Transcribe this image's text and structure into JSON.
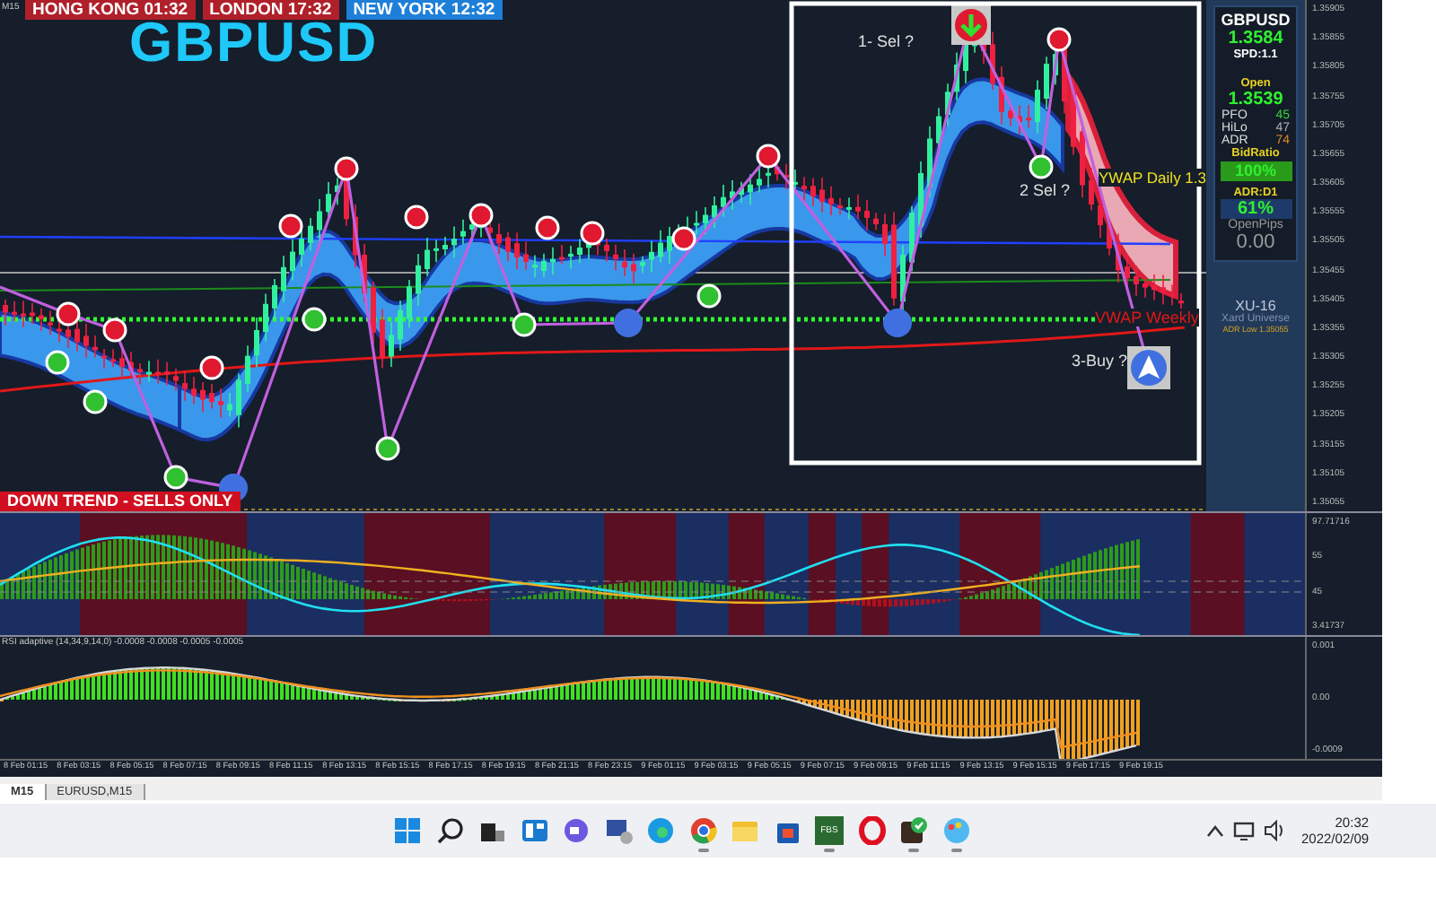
{
  "sessions": [
    {
      "label": "HONG KONG 01:32",
      "color": "#b0202a"
    },
    {
      "label": "LONDON  17:32",
      "color": "#b0202a"
    },
    {
      "label": "NEW YORK  12:32",
      "color": "#1e7fd8"
    }
  ],
  "chart": {
    "timeframe": "M15",
    "symbol_title": "GBPUSD",
    "trend_banner": "DOWN TREND - SELLS ONLY",
    "annotations": [
      {
        "text": "1- Sel ?",
        "kind": "note"
      },
      {
        "text": "YWAP Daily 1.3",
        "kind": "daily"
      },
      {
        "text": "2 Sel ?",
        "kind": "note"
      },
      {
        "text": "VWAP Weekly",
        "kind": "weekly"
      },
      {
        "text": "3-Buy ?",
        "kind": "note"
      }
    ]
  },
  "info_panel": {
    "symbol": "GBPUSD",
    "bid": "1.3584",
    "spread": "SPD:1.1",
    "open_label": "Open",
    "open_value": "1.3539",
    "stats": [
      {
        "label": "PFO",
        "value": "45",
        "color": "#3cd23c"
      },
      {
        "label": "HiLo",
        "value": "47",
        "color": "#b4b4b4"
      },
      {
        "label": "ADR",
        "value": "74",
        "color": "#e08a20"
      }
    ],
    "bid_ratio_label": "BidRatio",
    "bid_ratio": "100%",
    "bid_ratio_meter": {
      "level": 1
    },
    "adr_label": "ADR:D1",
    "adr_value": "61%",
    "open_pips_label": "OpenPips",
    "open_pips": "0.00",
    "brand": "XU-16",
    "brand_sub": "Xard Universe",
    "adr_low": "ADR Low 1.35055"
  },
  "price_axis": [
    "1.35905",
    "1.35855",
    "1.35805",
    "1.35755",
    "1.35705",
    "1.35655",
    "1.35605",
    "1.35555",
    "1.35505",
    "1.35455",
    "1.35405",
    "1.35355",
    "1.35305",
    "1.35255",
    "1.35205",
    "1.35155",
    "1.35105",
    "1.35055"
  ],
  "oscillator_axis": [
    "97.71716",
    "55",
    "45",
    "3.41737"
  ],
  "rsi": {
    "label": "RSI adaptive (14,34,9,14,0) -0.0008 -0.0008 -0.0005 -0.0005",
    "axis": [
      "0.001",
      "0.00",
      "-0.0009"
    ]
  },
  "time_axis": [
    "8 Feb 01:15",
    "8 Feb 03:15",
    "8 Feb 05:15",
    "8 Feb 07:15",
    "8 Feb 09:15",
    "8 Feb 11:15",
    "8 Feb 13:15",
    "8 Feb 15:15",
    "8 Feb 17:15",
    "8 Feb 19:15",
    "8 Feb 21:15",
    "8 Feb 23:15",
    "9 Feb 01:15",
    "9 Feb 03:15",
    "9 Feb 05:15",
    "9 Feb 07:15",
    "9 Feb 09:15",
    "9 Feb 11:15",
    "9 Feb 13:15",
    "9 Feb 15:15",
    "9 Feb 17:15",
    "9 Feb 19:15"
  ],
  "tabs": [
    {
      "label": "M15",
      "selected": true
    },
    {
      "label": "EURUSD,M15",
      "selected": false
    }
  ],
  "taskbar": {
    "apps": [
      {
        "kind": "start",
        "running": false
      },
      {
        "kind": "search",
        "running": false
      },
      {
        "kind": "taskview",
        "running": false
      },
      {
        "kind": "widgets",
        "running": false
      },
      {
        "kind": "chat",
        "running": false
      },
      {
        "kind": "monitor",
        "running": false
      },
      {
        "kind": "edge",
        "running": false
      },
      {
        "kind": "chrome",
        "running": true
      },
      {
        "kind": "folder",
        "running": false
      },
      {
        "kind": "store",
        "running": false
      },
      {
        "kind": "fbs",
        "label": "FBS",
        "running": true
      },
      {
        "kind": "opera",
        "running": false
      },
      {
        "kind": "tick",
        "running": true
      },
      {
        "kind": "paint",
        "running": true
      }
    ],
    "time": "20:32",
    "date": "2022/02/09"
  }
}
